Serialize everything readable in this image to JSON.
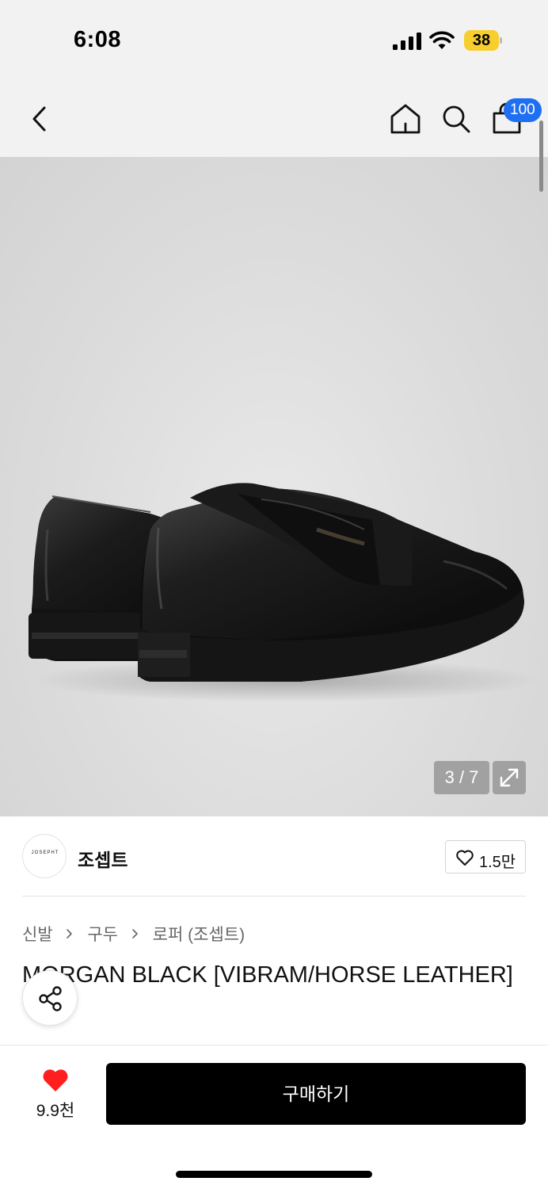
{
  "status_bar": {
    "time": "6:08",
    "battery_level": "38",
    "battery_color": "#f7ce2e",
    "icons": [
      "signal-icon",
      "wifi-icon",
      "battery-icon"
    ]
  },
  "nav": {
    "icons": [
      "back-icon",
      "home-icon",
      "search-icon",
      "shopping-bag-icon"
    ],
    "cart_count": "100",
    "badge_color": "#1f6ff2"
  },
  "gallery": {
    "counter": "3 / 7",
    "current": 3,
    "total": 7,
    "expand_icon": "expand-icon"
  },
  "brand": {
    "logo_text": "JOSEPHT",
    "name": "조셉트",
    "like_count": "1.5만"
  },
  "breadcrumb": {
    "items": [
      "신발",
      "구두",
      "로퍼 (조셉트)"
    ]
  },
  "product": {
    "title": "MORGAN BLACK [VIBRAM/HORSE LEATHER]"
  },
  "bottom": {
    "like_count": "9.9천",
    "like_color": "#ff1f1f",
    "buy_label": "구매하기"
  }
}
